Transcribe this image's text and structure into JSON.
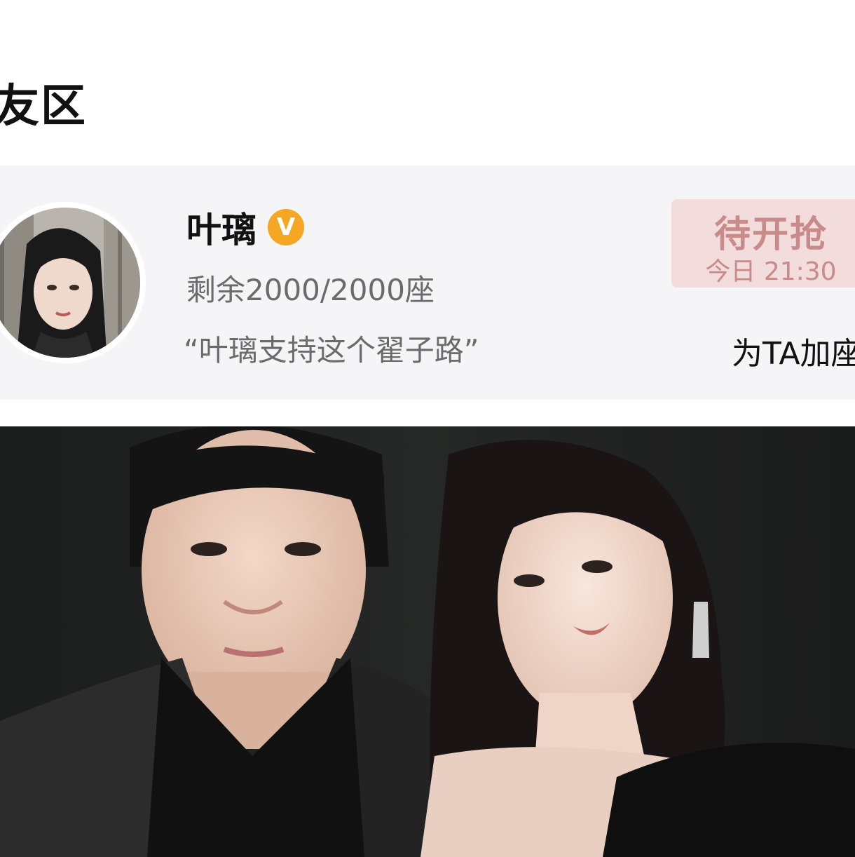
{
  "section": {
    "title": "友区"
  },
  "card": {
    "avatar_icon": "profile-photo",
    "name": "叶璃",
    "verified_badge": "V",
    "verified_color": "#f5a623",
    "seats": "剩余2000/2000座",
    "quote": "“叶璃支持这个翟子路”",
    "grab_button": {
      "label": "待开抢",
      "time": "今日 21:30"
    },
    "add_seat_label": "为TA加座"
  },
  "colors": {
    "card_background": "#f5f5f7",
    "button_background": "#f2dcdc",
    "button_text": "#c98a8a",
    "secondary_text": "#6b6b6b"
  }
}
